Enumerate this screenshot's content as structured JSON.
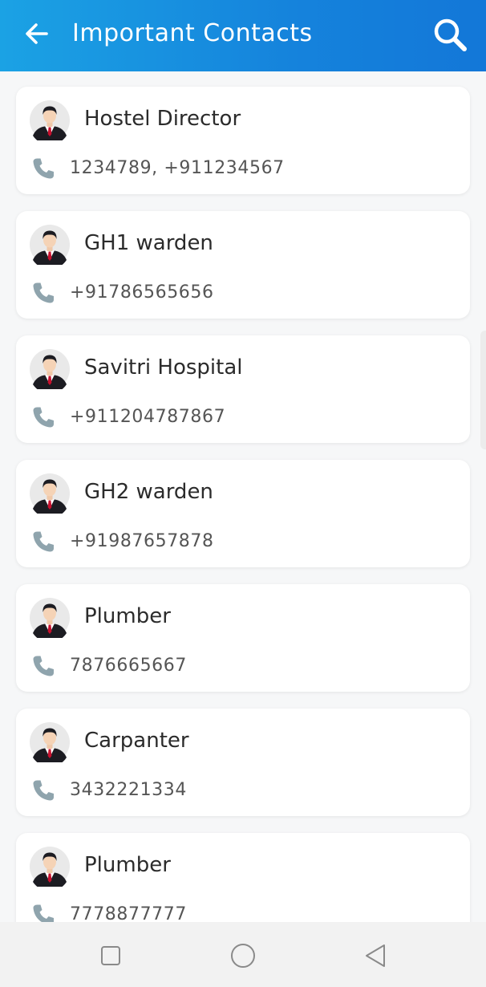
{
  "header": {
    "title": "Important Contacts",
    "back_icon": "arrow-left-icon",
    "search_icon": "search-icon"
  },
  "contacts": [
    {
      "name": "Hostel Director",
      "phone": "1234789, +911234567"
    },
    {
      "name": "GH1 warden",
      "phone": "+91786565656"
    },
    {
      "name": "Savitri Hospital",
      "phone": "+911204787867"
    },
    {
      "name": "GH2 warden",
      "phone": "+91987657878"
    },
    {
      "name": "Plumber",
      "phone": "7876665667"
    },
    {
      "name": "Carpanter",
      "phone": "3432221334"
    },
    {
      "name": "Plumber",
      "phone": "7778877777"
    }
  ],
  "navbar": {
    "icons": [
      "recent-apps-icon",
      "home-icon",
      "back-triangle-icon"
    ]
  },
  "colors": {
    "appbar_start": "#1ba2e4",
    "appbar_end": "#1377d8",
    "phone_icon": "#8fa4ad",
    "tie": "#c8102e"
  }
}
